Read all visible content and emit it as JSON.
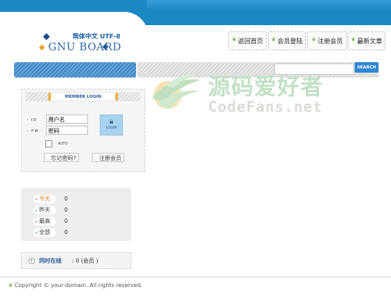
{
  "logo": {
    "subtitle": "简体中文 UTF-8",
    "name": "GNU BOARD"
  },
  "top_menu": [
    {
      "label": "返回首页"
    },
    {
      "label": "会员登陆"
    },
    {
      "label": "注册会员"
    },
    {
      "label": "最新文章"
    }
  ],
  "search": {
    "button_label": "SEARCH",
    "value": ""
  },
  "watermark": {
    "title": "源码爱好者",
    "subtitle": "CodeFans.net"
  },
  "login": {
    "title": "MEMBER LOGIN",
    "id_label": "I D",
    "pw_label": "P W",
    "id_value": "用户名",
    "pw_value": "密码",
    "login_button": "LOGIN",
    "auto_label": "AUTO",
    "forgot_label": "忘记密码?",
    "register_label": "注册会员"
  },
  "stats": [
    {
      "label": "今天",
      "value": "0"
    },
    {
      "label": "昨天",
      "value": "0"
    },
    {
      "label": "最高",
      "value": "0"
    },
    {
      "label": "全部",
      "value": "0"
    }
  ],
  "online": {
    "label": "同时在线",
    "value": ": 0 (会员 )"
  },
  "footer": {
    "copyright": "Copyright © your-domain. All rights reserved."
  },
  "colors": {
    "header_blue": "#1b88c4",
    "nav_blue": "#3f86c4",
    "search_button": "#2f86d4",
    "accent_orange": "#f2b34a",
    "sprout_green": "#6cb33e"
  },
  "icons": {
    "login_button": "lock-icon",
    "menu_items": "sprout-icon"
  }
}
